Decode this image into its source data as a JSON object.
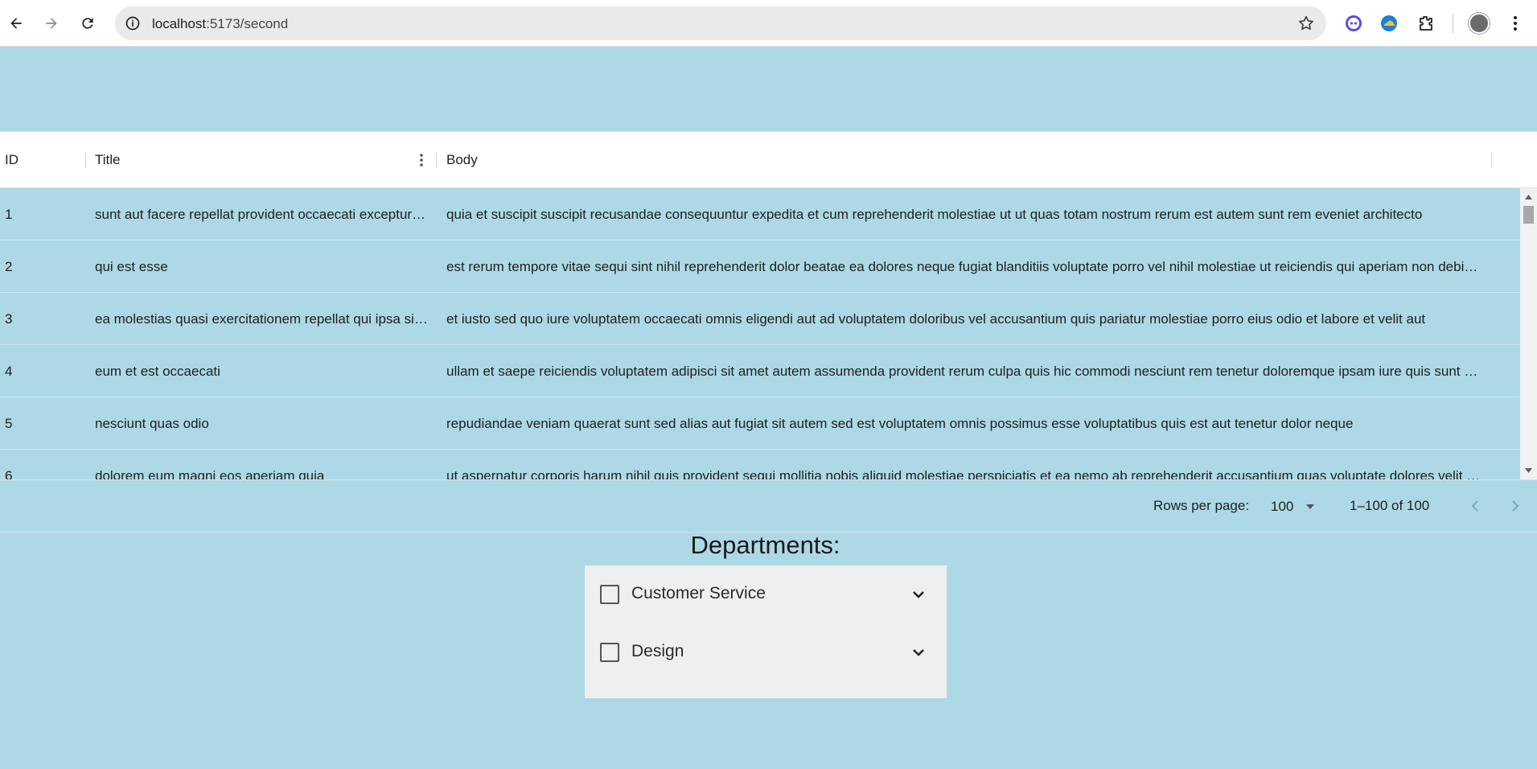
{
  "browser": {
    "url_host": "localhost",
    "url_path": ":5173/second",
    "icons": [
      "back-arrow-icon",
      "forward-arrow-icon",
      "reload-icon",
      "site-info-icon",
      "bookmark-star-icon",
      "extension-icon",
      "extension-cloud-icon",
      "puzzle-extensions-icon",
      "profile-avatar",
      "chrome-menu-icon"
    ]
  },
  "grid": {
    "columns": [
      "ID",
      "Title",
      "Body"
    ],
    "rows": [
      {
        "id": "1",
        "title": "sunt aut facere repellat provident occaecati excepturi optio reprehenderit",
        "body": "quia et suscipit suscipit recusandae consequuntur expedita et cum reprehenderit molestiae ut ut quas totam nostrum rerum est autem sunt rem eveniet architecto"
      },
      {
        "id": "2",
        "title": "qui est esse",
        "body": "est rerum tempore vitae sequi sint nihil reprehenderit dolor beatae ea dolores neque fugiat blanditiis voluptate porro vel nihil molestiae ut reiciendis qui aperiam non debitis possimus qui neque nisi nulla"
      },
      {
        "id": "3",
        "title": "ea molestias quasi exercitationem repellat qui ipsa sit aut",
        "body": "et iusto sed quo iure voluptatem occaecati omnis eligendi aut ad voluptatem doloribus vel accusantium quis pariatur molestiae porro eius odio et labore et velit aut"
      },
      {
        "id": "4",
        "title": "eum et est occaecati",
        "body": "ullam et saepe reiciendis voluptatem adipisci sit amet autem assumenda provident rerum culpa quis hic commodi nesciunt rem tenetur doloremque ipsam iure quis sunt voluptatem rerum illo velit"
      },
      {
        "id": "5",
        "title": "nesciunt quas odio",
        "body": "repudiandae veniam quaerat sunt sed alias aut fugiat sit autem sed est voluptatem omnis possimus esse voluptatibus quis est aut tenetur dolor neque"
      },
      {
        "id": "6",
        "title": "dolorem eum magni eos aperiam quia",
        "body": "ut aspernatur corporis harum nihil quis provident sequi mollitia nobis aliquid molestiae perspiciatis et ea nemo ab reprehenderit accusantium quas voluptate dolores velit et doloremque molestiae"
      }
    ],
    "footer": {
      "rows_per_page_label": "Rows per page:",
      "rows_per_page_value": "100",
      "range_label": "1–100 of 100"
    }
  },
  "departments": {
    "title": "Departments:",
    "items": [
      {
        "label": "Customer Service",
        "checked": false
      },
      {
        "label": "Design",
        "checked": false
      }
    ]
  }
}
